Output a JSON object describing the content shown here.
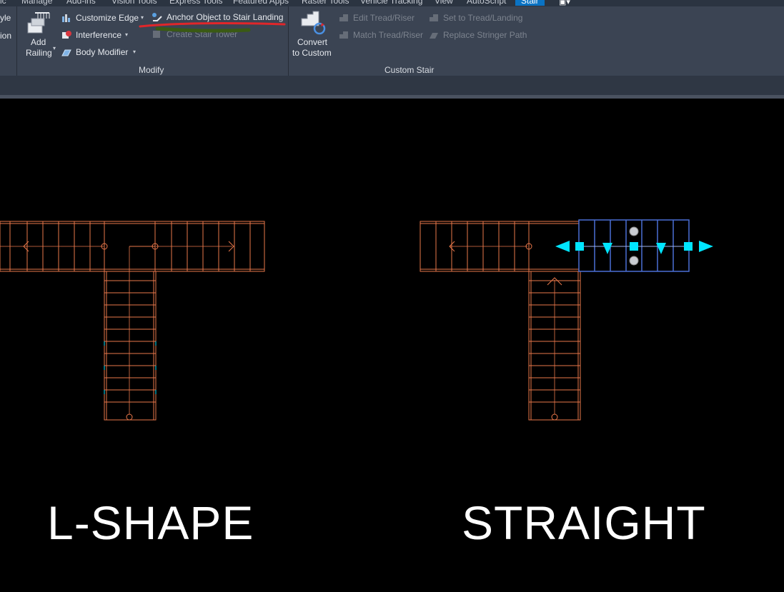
{
  "tabs": [
    {
      "label": "ic"
    },
    {
      "label": "Manage"
    },
    {
      "label": "Add-ins"
    },
    {
      "label": "Vision Tools"
    },
    {
      "label": "Express Tools"
    },
    {
      "label": "Featured Apps"
    },
    {
      "label": "Raster Tools"
    },
    {
      "label": "Vehicle Tracking"
    },
    {
      "label": "View"
    },
    {
      "label": "AutoScript"
    },
    {
      "label": "Stair"
    }
  ],
  "ribbon": {
    "cut_left_1": "yle",
    "cut_left_2": "ion",
    "add_railing_line1": "Add",
    "add_railing_line2": "Railing",
    "customize_edge": "Customize Edge",
    "interference": "Interference",
    "body_modifier": "Body Modifier",
    "anchor_object": "Anchor Object to Stair Landing",
    "create_stair_tower": "Create Stair Tower",
    "convert_line1": "Convert",
    "convert_line2": "to Custom",
    "edit_tread_riser": "Edit Tread/Riser",
    "match_tread_riser": "Match Tread/Riser",
    "set_to_tread_landing": "Set to Tread/Landing",
    "replace_stringer_path": "Replace Stringer Path",
    "panel_modify": "Modify",
    "panel_custom_stair": "Custom Stair"
  },
  "canvas": {
    "label_left": "L-SHAPE",
    "label_right": "STRAIGHT"
  },
  "colors": {
    "stair_lines": "#e8774a",
    "selection": "#4a6fd6",
    "grips": "#00e5ff",
    "annotation_red": "#e0262a",
    "annotation_green": "#3a5a14"
  }
}
